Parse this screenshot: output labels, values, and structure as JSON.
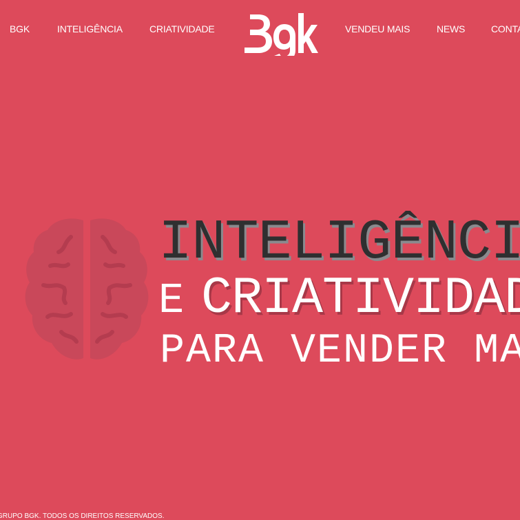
{
  "nav": {
    "left": [
      "BGK",
      "INTELIGÊNCIA",
      "CRIATIVIDADE"
    ],
    "right": [
      "VENDEU MAIS",
      "NEWS",
      "CONTATO"
    ]
  },
  "logo": {
    "text": "Bgk"
  },
  "hero": {
    "line1": "INTELIGÊNCIA",
    "line2_prefix": "E",
    "line2": "CRIATIVIDADE",
    "line3": "PARA VENDER MAIS",
    "icon": "brain-icon"
  },
  "footer": {
    "copyright": "GRUPO BGK. TODOS OS DIREITOS RESERVADOS."
  },
  "colors": {
    "background": "#dd4a5b",
    "dark_text": "#2f2f30",
    "light_text": "#ffffff",
    "brain": "#c9485a"
  }
}
